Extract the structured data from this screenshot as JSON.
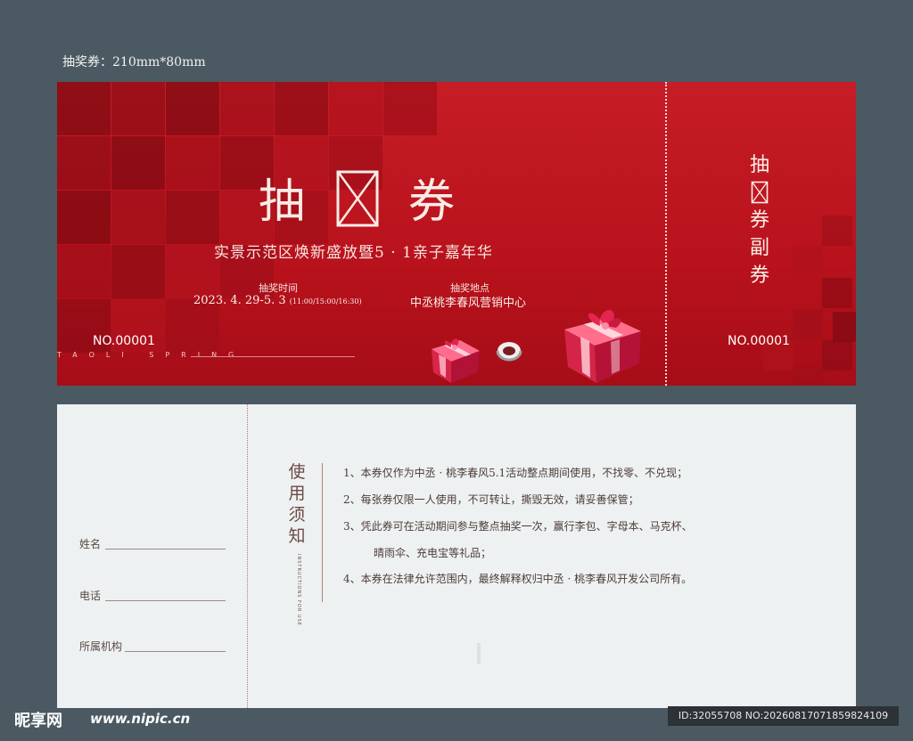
{
  "caption": "抽奖券：210mm*80mm",
  "front": {
    "title": "抽奖券",
    "title_chars": [
      "抽",
      "券"
    ],
    "subtitle": "实景示范区焕新盛放暨5 · 1亲子嘉年华",
    "time_label": "抽奖时间",
    "time_value": "2023. 4. 29-5. 3",
    "time_slots": "(11:00/15:00/16:30)",
    "place_label": "抽奖地点",
    "place_value": "中丞桃李春风营销中心",
    "serial": "NO.00001",
    "brand_line": "TAOLI SPRING",
    "colors": {
      "primary_red": "#c61d26",
      "dark_red": "#a60d17",
      "cream_text": "#f9ece6"
    }
  },
  "stub": {
    "title_chars": [
      "抽",
      "券",
      "副",
      "券"
    ],
    "serial": "NO.00001"
  },
  "back": {
    "fields": [
      {
        "label": "姓名"
      },
      {
        "label": "电话"
      },
      {
        "label": "所属机构"
      }
    ],
    "notice_title_chars": [
      "使",
      "用",
      "须",
      "知"
    ],
    "notice_en": "INSTRUCTIONS FOR USE",
    "rules": [
      "1、本券仅作为中丞 · 桃李春风5.1活动整点期间使用，不找零、不兑现；",
      "2、每张券仅限一人使用，不可转让，撕毁无效，请妥善保管；",
      "3、凭此券可在活动期间参与整点抽奖一次，赢行李包、字母本、马克杯、",
      "晴雨伞、充电宝等礼品；",
      "4、本券在法律允许范围内，最终解释权归中丞 · 桃李春风开发公司所有。"
    ]
  },
  "watermark": {
    "logo_text": "昵享网",
    "site": "www.nipic.cn",
    "id_text": "ID:32055708 NO:20260817071859824109"
  }
}
